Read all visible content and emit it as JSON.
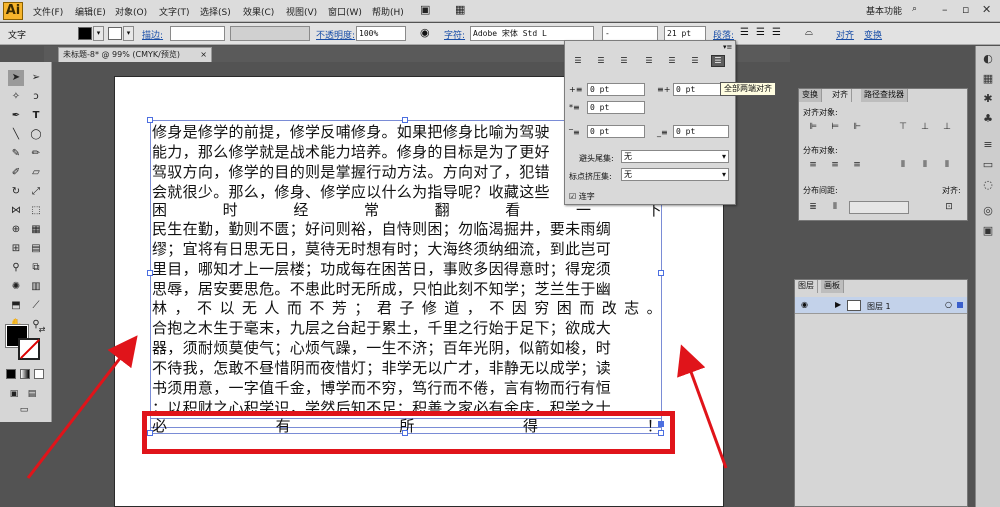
{
  "app": {
    "logo": "Ai"
  },
  "menu": [
    "文件(F)",
    "编辑(E)",
    "对象(O)",
    "文字(T)",
    "选择(S)",
    "效果(C)",
    "视图(V)",
    "窗口(W)",
    "帮助(H)"
  ],
  "workspace": "基本功能",
  "control_bar": {
    "tool_label": "文字",
    "stroke_label": "描边:",
    "opacity_label": "不透明度:",
    "opacity_value": "100%",
    "char_label": "字符:",
    "font_value": "Adobe 宋体 Std L",
    "font_style_value": "-",
    "font_size_value": "21 pt",
    "para_label": "段落:",
    "align_label": "对齐",
    "transform_label": "变换"
  },
  "document": {
    "tab_title": "未标题-8* @ 99% (CMYK/预览)"
  },
  "text_lines": [
    "修身是修学的前提，修学反哺修身。如果把修身比喻为驾驶",
    "能力，那么修学就是战术能力培养。修身的目标是为了更好",
    "驾驭方向，修学的目的则是掌握行动方法。方向对了，犯错",
    "会就很少。那么，修身、修学应以什么为指导呢？收藏这些",
    "困时经常翻看一下",
    "民生在勤，勤则不匮；好问则裕，自恃则困；勿临渴掘井，要未雨绸",
    "缪；宜将有日思无日，莫待无时想有时；大海终须纳细流，到此岂可",
    "里目，哪知才上一层楼；功成每在困苦日，事败多因得意时；得宠须",
    "思辱，居安要思危。不患此时无所成，只怕此刻不知学；芝兰生于幽",
    "林，不以无人而不芳；君子修道，不因穷困而改志。",
    "合抱之木生于毫末，九层之台起于累土，千里之行始于足下；欲成大",
    "器，须耐烦莫使气；心烦气躁，一生不济；百年光阴，似箭如梭，时",
    "不待我，怎敢不昼惜阴而夜惜灯；非学无以广才，非静无以成学；读",
    "书须用意，一字值千金，博学而不穷，笃行而不倦，言有物而行有恒",
    "；以积财之心积学识，学然后知不足；积善之家必有余庆，积学之士",
    "必有所得！"
  ],
  "paragraph_panel": {
    "indent_left": "0 pt",
    "indent_right": "0 pt",
    "first_line": "0 pt",
    "space_before": "0 pt",
    "space_after": "0 pt",
    "avoid_label": "避头尾集:",
    "avoid_value": "无",
    "punct_label": "标点挤压集:",
    "punct_value": "无",
    "hyphen_label": "连字",
    "tooltip": "全部两端对齐"
  },
  "align_panel": {
    "tabs": [
      "变换",
      "对齐",
      "路径查找器"
    ],
    "align_objects": "对齐对象:",
    "distribute_objects": "分布对象:",
    "distribute_spacing": "分布间距:",
    "align_to": "对齐:"
  },
  "layers_panel": {
    "tabs": [
      "图层",
      "画板"
    ],
    "layer_name": "图层 1"
  },
  "colors": {
    "annotation_red": "#e0141a",
    "frame_blue": "#7a8cd6",
    "panel_gray": "#d6d6d6"
  }
}
